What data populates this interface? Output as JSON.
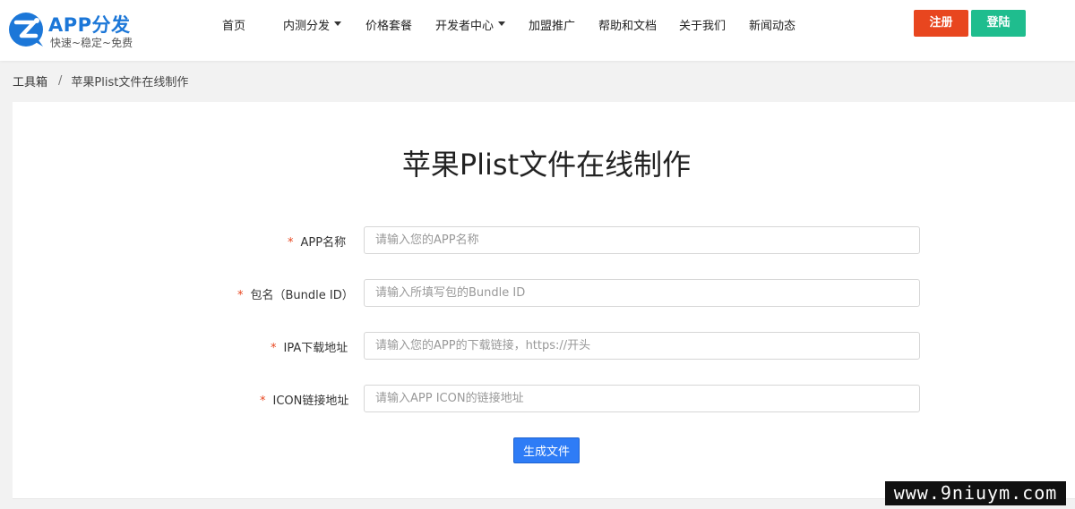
{
  "header": {
    "logo_title": "APP分发",
    "logo_subtitle": "快速~稳定~免费",
    "nav": [
      {
        "label": "首页"
      },
      {
        "label": "内测分发",
        "dropdown": true
      },
      {
        "label": "价格套餐"
      },
      {
        "label": "开发者中心",
        "dropdown": true
      },
      {
        "label": "加盟推广"
      },
      {
        "label": "帮助和文档"
      },
      {
        "label": "关于我们"
      },
      {
        "label": "新闻动态"
      }
    ],
    "register_label": "注册",
    "login_label": "登陆",
    "colors": {
      "brand": "#1c77d8",
      "register": "#e8461f",
      "login": "#1fbd8e"
    }
  },
  "breadcrumb": {
    "root": "工具箱",
    "separator": "/",
    "current": "苹果Plist文件在线制作"
  },
  "main": {
    "title": "苹果Plist文件在线制作",
    "form": {
      "required_mark": "*",
      "fields": [
        {
          "label": "APP名称",
          "value": "",
          "placeholder": "请输入您的APP名称"
        },
        {
          "label": "包名（Bundle ID）",
          "value": "",
          "placeholder": "请输入所填写包的Bundle ID"
        },
        {
          "label": "IPA下载地址",
          "value": "",
          "placeholder": "请输入您的APP的下载链接，https://开头"
        },
        {
          "label": "ICON链接地址",
          "value": "",
          "placeholder": "请输入APP ICON的链接地址"
        }
      ],
      "submit_label": "生成文件",
      "submit_color": "#2e7cf6"
    }
  },
  "watermark": "www.9niuym.com"
}
